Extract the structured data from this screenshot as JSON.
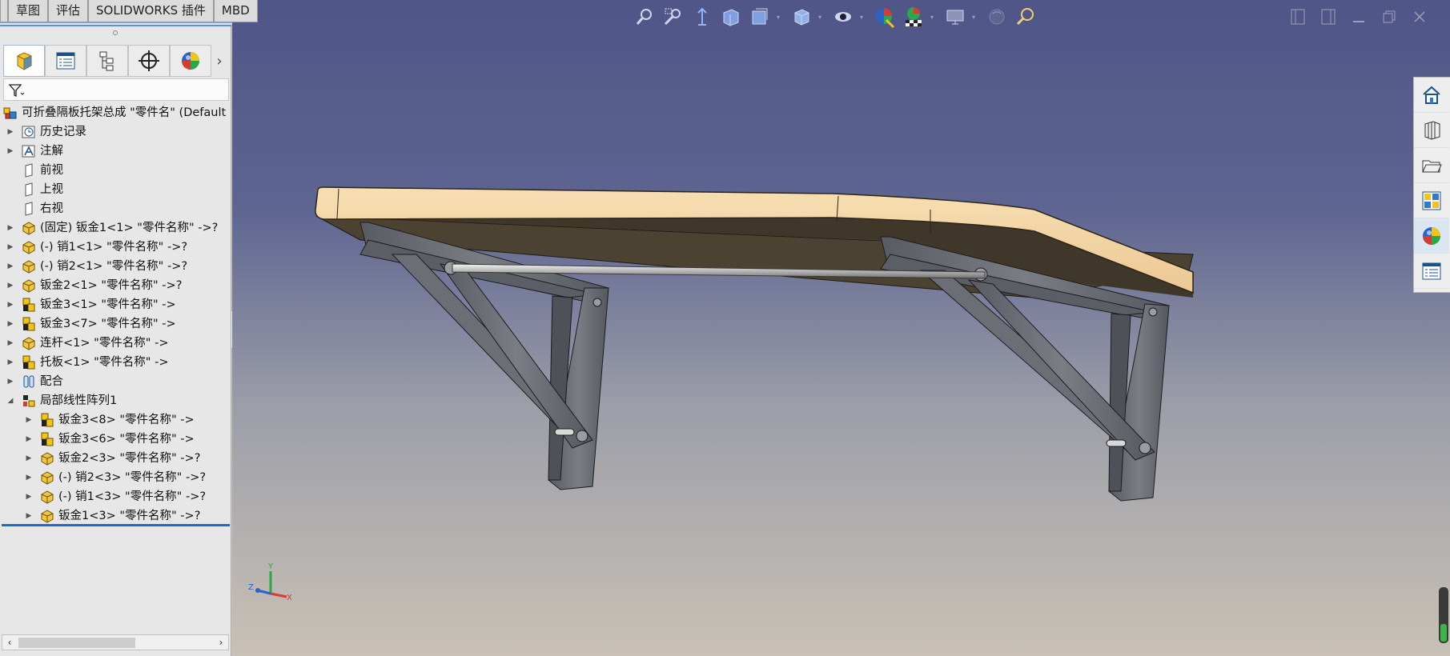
{
  "command_tabs": [
    {
      "label": ""
    },
    {
      "label": "草图"
    },
    {
      "label": "评估"
    },
    {
      "label": "SOLIDWORKS 插件"
    },
    {
      "label": "MBD"
    }
  ],
  "manager_tabs": [
    {
      "icon": "feature-manager-icon",
      "active": true
    },
    {
      "icon": "property-manager-icon",
      "active": false
    },
    {
      "icon": "configuration-manager-icon",
      "active": false
    },
    {
      "icon": "dimxpert-manager-icon",
      "active": false
    },
    {
      "icon": "display-manager-icon",
      "active": false
    }
  ],
  "manager_more_symbol": "›",
  "filter": {
    "icon": "filter-icon"
  },
  "tree": {
    "root": {
      "label": "可折叠隔板托架总成 \"零件名\"  (Default"
    },
    "items": [
      {
        "label": "历史记录",
        "icon": "history-icon",
        "level": 1,
        "expandable": true
      },
      {
        "label": "注解",
        "icon": "annotation-icon",
        "level": 1,
        "expandable": true
      },
      {
        "label": "前视",
        "icon": "plane-icon",
        "level": 1,
        "expandable": false
      },
      {
        "label": "上视",
        "icon": "plane-icon",
        "level": 1,
        "expandable": false
      },
      {
        "label": "右视",
        "icon": "plane-icon",
        "level": 1,
        "expandable": false
      },
      {
        "label": "(固定) 钣金1<1> \"零件名称\" ->?",
        "icon": "part-icon",
        "level": 1,
        "expandable": true
      },
      {
        "label": "(-) 销1<1> \"零件名称\" ->?",
        "icon": "part-icon",
        "level": 1,
        "expandable": true
      },
      {
        "label": "(-) 销2<1> \"零件名称\" ->?",
        "icon": "part-icon",
        "level": 1,
        "expandable": true
      },
      {
        "label": "钣金2<1> \"零件名称\" ->?",
        "icon": "part-icon",
        "level": 1,
        "expandable": true
      },
      {
        "label": "钣金3<1> \"零件名称\" ->",
        "icon": "subassembly-icon",
        "level": 1,
        "expandable": true
      },
      {
        "label": "钣金3<7> \"零件名称\" ->",
        "icon": "subassembly-icon",
        "level": 1,
        "expandable": true
      },
      {
        "label": "连杆<1> \"零件名称\" ->",
        "icon": "part-icon",
        "level": 1,
        "expandable": true
      },
      {
        "label": "托板<1> \"零件名称\" ->",
        "icon": "subassembly-icon",
        "level": 1,
        "expandable": true
      },
      {
        "label": "配合",
        "icon": "mates-icon",
        "level": 1,
        "expandable": true
      },
      {
        "label": "局部线性阵列1",
        "icon": "pattern-icon",
        "level": 1,
        "expandable": true,
        "expanded": true
      },
      {
        "label": "钣金3<8> \"零件名称\" ->",
        "icon": "subassembly-icon",
        "level": 2,
        "expandable": true
      },
      {
        "label": "钣金3<6> \"零件名称\" ->",
        "icon": "subassembly-icon",
        "level": 2,
        "expandable": true
      },
      {
        "label": "钣金2<3> \"零件名称\" ->?",
        "icon": "part-icon",
        "level": 2,
        "expandable": true
      },
      {
        "label": "(-) 销2<3> \"零件名称\" ->?",
        "icon": "part-icon",
        "level": 2,
        "expandable": true
      },
      {
        "label": "(-) 销1<3> \"零件名称\" ->?",
        "icon": "part-icon",
        "level": 2,
        "expandable": true
      },
      {
        "label": "钣金1<3> \"零件名称\" ->?",
        "icon": "part-icon",
        "level": 2,
        "expandable": true
      }
    ]
  },
  "scrollbar": {
    "left_symbol": "‹",
    "right_symbol": "›"
  },
  "heads_up_toolbar": [
    {
      "icon": "zoom-to-fit-icon"
    },
    {
      "icon": "zoom-to-area-icon"
    },
    {
      "icon": "previous-view-icon"
    },
    {
      "icon": "section-view-icon"
    },
    {
      "icon": "dynamic-annotation-view-icon",
      "dropdown": true
    },
    {
      "icon": "view-orientation-icon",
      "dropdown": true
    },
    {
      "icon": "display-style-icon",
      "dropdown": true
    },
    {
      "icon": "hide-show-items-icon"
    },
    {
      "icon": "edit-appearance-icon"
    },
    {
      "icon": "apply-scene-icon",
      "dropdown": true
    },
    {
      "icon": "view-settings-icon",
      "dropdown": true
    },
    {
      "icon": "realview-icon"
    },
    {
      "icon": "measure-zoom-icon"
    }
  ],
  "window_controls": [
    {
      "icon": "tile-left-icon"
    },
    {
      "icon": "tile-right-icon"
    },
    {
      "icon": "minimize-icon"
    },
    {
      "icon": "restore-icon"
    },
    {
      "icon": "close-icon"
    }
  ],
  "task_pane": [
    {
      "icon": "solidworks-resources-icon",
      "active": false
    },
    {
      "icon": "design-library-icon",
      "active": false
    },
    {
      "icon": "file-explorer-icon",
      "active": false
    },
    {
      "icon": "view-palette-icon",
      "active": false
    },
    {
      "icon": "appearances-scenes-icon",
      "active": true
    },
    {
      "icon": "custom-properties-icon",
      "active": false
    }
  ],
  "triad": {
    "x_label": "X",
    "y_label": "Y",
    "z_label": "Z"
  },
  "colors": {
    "accent_blue": "#1d6bc2",
    "shelf_top": "#f2d6a8",
    "shelf_underside": "#4b4232",
    "bracket_gray": "#6e7178",
    "viewport_top": "#4f5587",
    "viewport_bottom": "#c9c1b6"
  }
}
